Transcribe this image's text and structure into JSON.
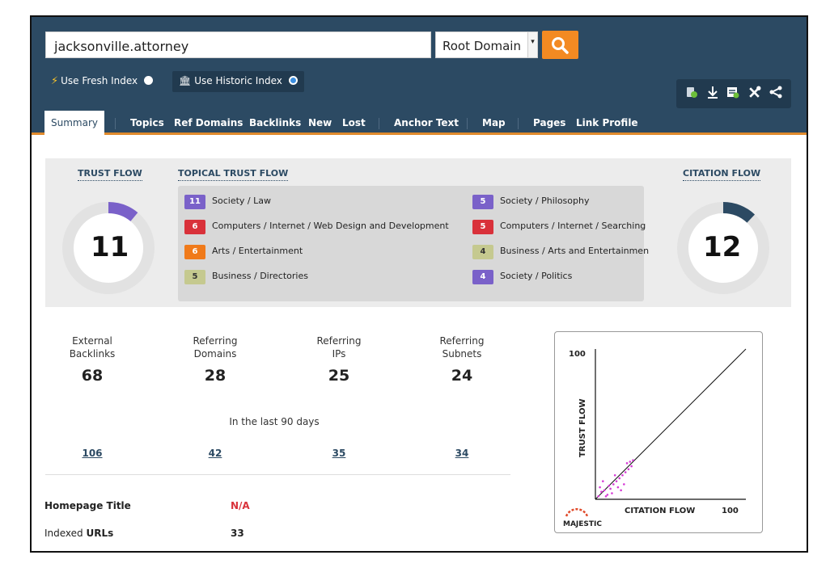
{
  "search": {
    "query": "jacksonville.attorney",
    "scope": "Root Domain"
  },
  "index": {
    "fresh_label": "Use Fresh Index",
    "historic_label": "Use Historic Index"
  },
  "toolbar_icons": [
    "bulk-icon",
    "download-icon",
    "report-icon",
    "tools-icon",
    "share-icon"
  ],
  "tabs": [
    "Summary",
    "Topics",
    "Ref Domains",
    "Backlinks",
    "New",
    "Lost",
    "Anchor Text",
    "Map",
    "Pages",
    "Link Profile"
  ],
  "summary": {
    "trust_flow_label": "TRUST FLOW",
    "topical_label": "TOPICAL TRUST FLOW",
    "citation_flow_label": "CITATION FLOW",
    "trust_flow": "11",
    "citation_flow": "12",
    "trust_flow_fraction": 0.11,
    "citation_flow_fraction": 0.12,
    "topics": [
      {
        "score": "11",
        "label": "Society / Law",
        "color": "#7a61c9"
      },
      {
        "score": "6",
        "label": "Computers / Internet / Web Design and Development",
        "color": "#d9313a"
      },
      {
        "score": "6",
        "label": "Arts / Entertainment",
        "color": "#f07a1a"
      },
      {
        "score": "5",
        "label": "Business / Directories",
        "color": "#c5c98f"
      },
      {
        "score": "5",
        "label": "Society / Philosophy",
        "color": "#7a61c9"
      },
      {
        "score": "5",
        "label": "Computers / Internet / Searching",
        "color": "#d9313a"
      },
      {
        "score": "4",
        "label": "Business / Arts and Entertainmen",
        "color": "#c5c98f"
      },
      {
        "score": "4",
        "label": "Society / Politics",
        "color": "#7a61c9"
      }
    ]
  },
  "stats": {
    "labels": [
      [
        "External",
        "Backlinks"
      ],
      [
        "Referring",
        "Domains"
      ],
      [
        "Referring",
        "IPs"
      ],
      [
        "Referring",
        "Subnets"
      ]
    ],
    "values": [
      "68",
      "28",
      "25",
      "24"
    ],
    "last90_label": "In the last 90 days",
    "last90_values": [
      "106",
      "42",
      "35",
      "34"
    ]
  },
  "info": {
    "homepage_title_label": "Homepage Title",
    "homepage_title_value": "N/A",
    "indexed_label_prefix": "Indexed ",
    "indexed_label_strong": "URLs",
    "indexed_value": "33"
  },
  "colors": {
    "header": "#2c4a63",
    "accent": "#f38a22",
    "tf_arc": "#7a61c9",
    "cf_arc": "#2c4a63",
    "na_red": "#d9313a"
  },
  "chart_data": {
    "type": "scatter",
    "xlabel": "CITATION FLOW",
    "ylabel": "TRUST FLOW",
    "xlim": [
      0,
      100
    ],
    "ylim": [
      0,
      100
    ],
    "x_max_label": "100",
    "y_max_label": "100",
    "brand": "MAJESTIC",
    "reference_line": "diagonal",
    "points": [
      [
        2,
        2
      ],
      [
        4,
        5
      ],
      [
        6,
        6
      ],
      [
        3,
        8
      ],
      [
        8,
        3
      ],
      [
        10,
        7
      ],
      [
        12,
        10
      ],
      [
        14,
        12
      ],
      [
        16,
        14
      ],
      [
        18,
        16
      ],
      [
        20,
        18
      ],
      [
        22,
        20
      ],
      [
        24,
        22
      ],
      [
        5,
        12
      ],
      [
        7,
        2
      ],
      [
        11,
        4
      ],
      [
        13,
        16
      ],
      [
        9,
        9
      ],
      [
        15,
        8
      ],
      [
        17,
        6
      ],
      [
        19,
        10
      ],
      [
        21,
        24
      ],
      [
        23,
        25
      ],
      [
        25,
        26
      ]
    ]
  }
}
